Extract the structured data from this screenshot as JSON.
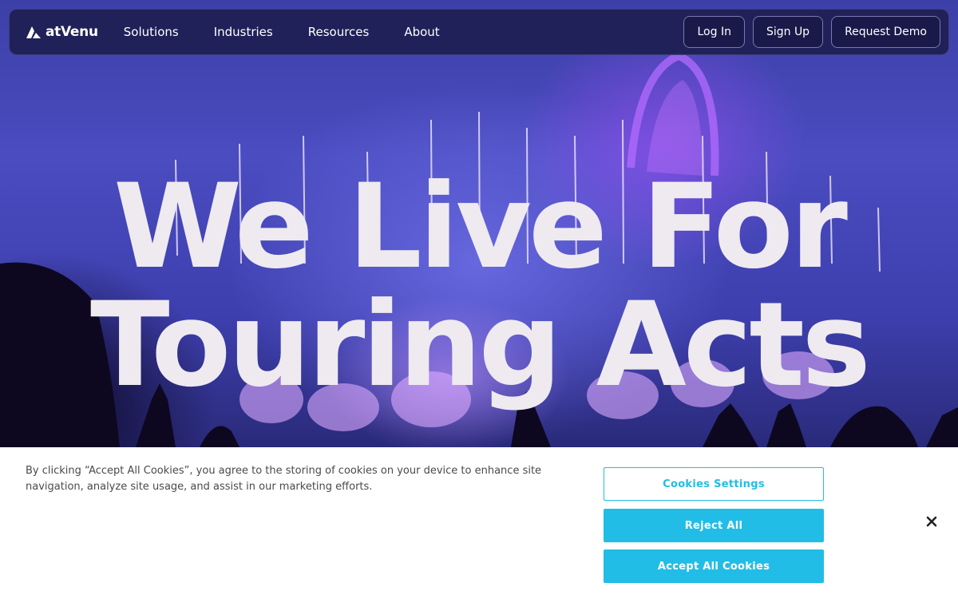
{
  "nav": {
    "logo_text": "atVenu",
    "links": [
      "Solutions",
      "Industries",
      "Resources",
      "About"
    ],
    "login_label": "Log In",
    "signup_label": "Sign Up",
    "demo_label": "Request Demo"
  },
  "hero": {
    "headline_line1": "We Live For",
    "headline_line2": "Touring Acts"
  },
  "cookie_banner": {
    "text": "By clicking “Accept All Cookies”, you agree to the storing of cookies on your device to enhance site navigation, analyze site usage, and assist in our marketing efforts.",
    "settings_label": "Cookies Settings",
    "reject_label": "Reject All",
    "accept_label": "Accept All Cookies",
    "close_icon": "close-icon"
  },
  "colors": {
    "accent": "#22bde7",
    "nav_bg": "#1c1e50",
    "hero_purple": "#4a4cc0",
    "headline": "#eeeaf0"
  }
}
